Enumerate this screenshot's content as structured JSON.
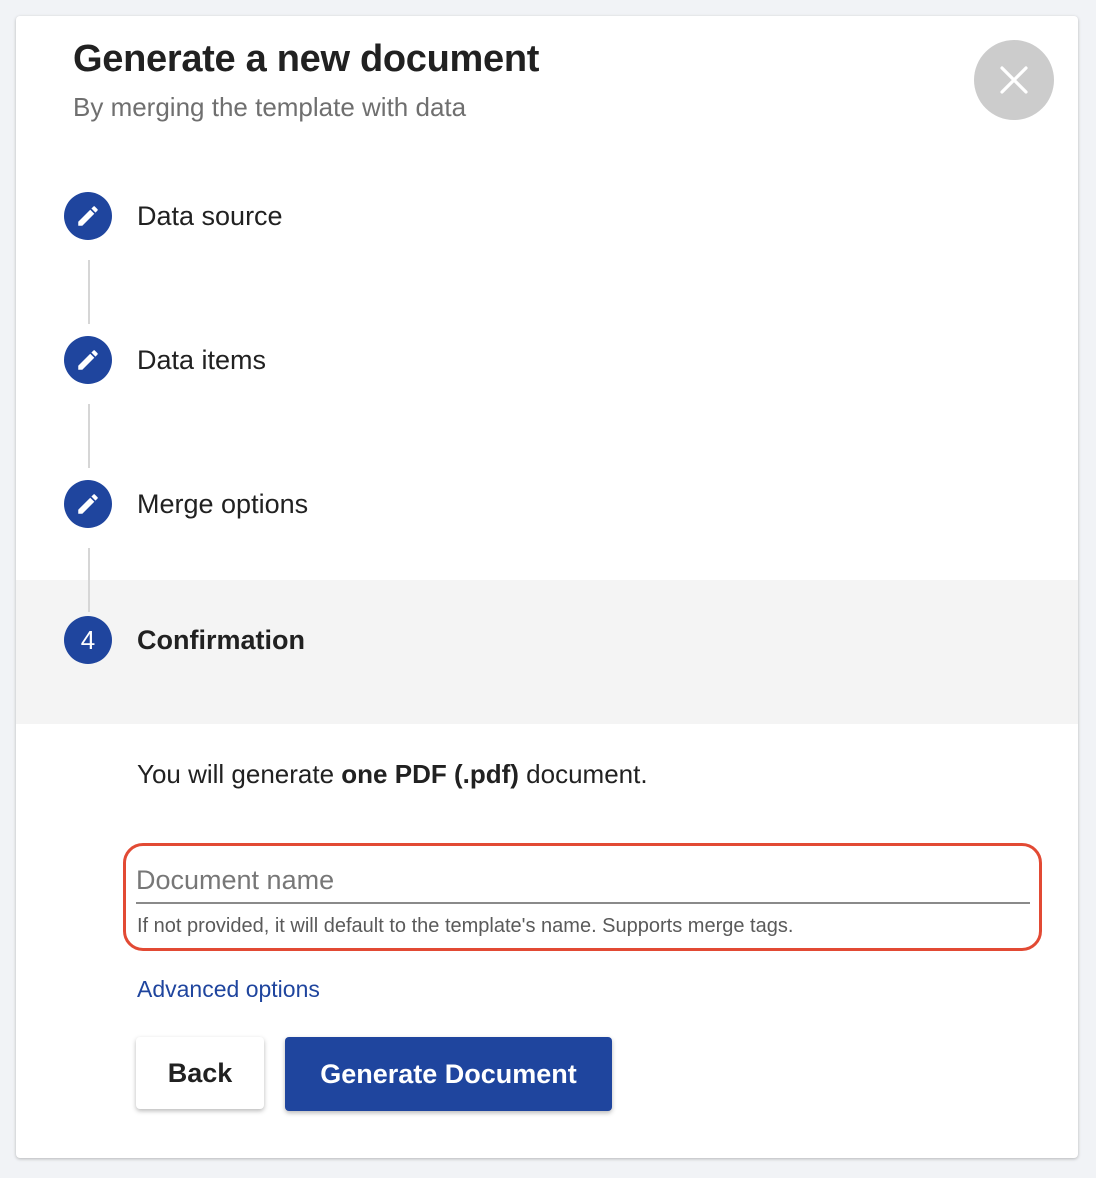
{
  "dialog": {
    "title": "Generate a new document",
    "subtitle": "By merging the template with data",
    "close_icon": "close-icon"
  },
  "steps": [
    {
      "label": "Data source",
      "icon": "pencil-icon",
      "state": "completed"
    },
    {
      "label": "Data items",
      "icon": "pencil-icon",
      "state": "completed"
    },
    {
      "label": "Merge options",
      "icon": "pencil-icon",
      "state": "completed"
    },
    {
      "label": "Confirmation",
      "number": "4",
      "state": "active"
    }
  ],
  "confirmation": {
    "summary_prefix": "You will generate ",
    "summary_bold": "one PDF (.pdf)",
    "summary_suffix": " document.",
    "document_name": {
      "placeholder": "Document name",
      "value": "",
      "helper": "If not provided, it will default to the template's name. Supports merge tags."
    },
    "advanced_options_label": "Advanced options",
    "back_label": "Back",
    "generate_label": "Generate Document"
  },
  "colors": {
    "primary": "#1f459e",
    "highlight": "#e24a34",
    "close_bg": "#cccccc",
    "active_step_bg": "#f4f4f4"
  }
}
